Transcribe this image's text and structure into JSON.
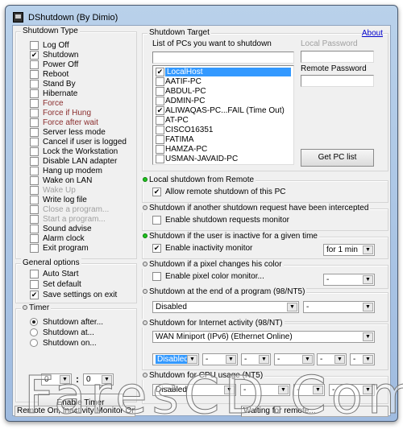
{
  "window": {
    "title": "DShutdown (By Dimio)"
  },
  "shutdown_type": {
    "label": "Shutdown Type",
    "items": [
      {
        "label": "Log Off",
        "checked": false,
        "style": "normal"
      },
      {
        "label": "Shutdown",
        "checked": true,
        "style": "normal"
      },
      {
        "label": "Power Off",
        "checked": false,
        "style": "normal"
      },
      {
        "label": "Reboot",
        "checked": false,
        "style": "normal"
      },
      {
        "label": "Stand By",
        "checked": false,
        "style": "normal"
      },
      {
        "label": "Hibernate",
        "checked": false,
        "style": "normal"
      },
      {
        "label": "Force",
        "checked": false,
        "style": "red"
      },
      {
        "label": "Force if Hung",
        "checked": false,
        "style": "red"
      },
      {
        "label": "Force after wait",
        "checked": false,
        "style": "red"
      },
      {
        "label": "Server less mode",
        "checked": false,
        "style": "normal"
      },
      {
        "label": "Cancel if user is logged",
        "checked": false,
        "style": "normal"
      },
      {
        "label": "Lock the Workstation",
        "checked": false,
        "style": "normal"
      },
      {
        "label": "Disable LAN adapter",
        "checked": false,
        "style": "normal"
      },
      {
        "label": "Hang up modem",
        "checked": false,
        "style": "normal"
      },
      {
        "label": "Wake on LAN",
        "checked": false,
        "style": "normal"
      },
      {
        "label": "Wake Up",
        "checked": false,
        "style": "disabled"
      },
      {
        "label": "Write log file",
        "checked": false,
        "style": "normal"
      },
      {
        "label": "Close a program...",
        "checked": false,
        "style": "disabled"
      },
      {
        "label": "Start a program...",
        "checked": false,
        "style": "disabled"
      },
      {
        "label": "Sound advise",
        "checked": false,
        "style": "normal"
      },
      {
        "label": "Alarm clock",
        "checked": false,
        "style": "normal"
      },
      {
        "label": "Exit program",
        "checked": false,
        "style": "normal"
      }
    ]
  },
  "general_options": {
    "label": "General options",
    "items": [
      {
        "label": "Auto Start",
        "checked": false
      },
      {
        "label": "Set default",
        "checked": false
      },
      {
        "label": "Save settings on exit",
        "checked": true
      }
    ]
  },
  "timer": {
    "label": "Timer",
    "active": false,
    "options": [
      {
        "label": "Shutdown after...",
        "selected": true
      },
      {
        "label": "Shutdown at...",
        "selected": false
      },
      {
        "label": "Shutdown on...",
        "selected": false
      }
    ],
    "hours": "0",
    "separator": ":",
    "minutes": "0",
    "button": "Enable Timer"
  },
  "target": {
    "label": "Shutdown Target",
    "about": "About",
    "list_label": "List of PCs you want to shutdown",
    "list_input": "",
    "local_password_label": "Local Password",
    "local_password": "",
    "remote_password_label": "Remote Password",
    "remote_password": "",
    "get_pc_list": "Get PC list",
    "pcs": [
      {
        "name": "LocalHost",
        "checked": true,
        "selected": true
      },
      {
        "name": "AATIF-PC",
        "checked": false
      },
      {
        "name": "ABDUL-PC",
        "checked": false
      },
      {
        "name": "ADMIN-PC",
        "checked": false
      },
      {
        "name": "ALIWAQAS-PC...FAIL (Time Out)",
        "checked": true
      },
      {
        "name": "AT-PC",
        "checked": false
      },
      {
        "name": "CISCO16351",
        "checked": false
      },
      {
        "name": "FATIMA",
        "checked": false
      },
      {
        "name": "HAMZA-PC",
        "checked": false
      },
      {
        "name": "USMAN-JAVAID-PC",
        "checked": false
      }
    ]
  },
  "remote": {
    "label": "Local shutdown from Remote",
    "active": true,
    "option": "Allow remote shutdown of this PC",
    "checked": true
  },
  "intercept": {
    "label": "Shutdown if another shutdown request have been intercepted",
    "active": false,
    "option": "Enable shutdown requests monitor",
    "checked": false
  },
  "inactive": {
    "label": "Shutdown if the user is inactive for a given time",
    "active": true,
    "option": "Enable inactivity monitor",
    "checked": true,
    "duration": "for 1 min"
  },
  "pixel": {
    "label": "Shutdown if a pixel changes his color",
    "active": false,
    "option": "Enable pixel color monitor...",
    "checked": false,
    "value": "-"
  },
  "program_end": {
    "label": "Shutdown at the end of a program (98/NT5)",
    "active": false,
    "program": "Disabled",
    "value": "-"
  },
  "internet": {
    "label": "Shutdown for Internet activity (98/NT)",
    "active": false,
    "adapter": "WAN Miniport (IPv6) (Ethernet Online)",
    "mode": "Disabled",
    "values": [
      "-",
      "-",
      "-",
      "-",
      "-"
    ]
  },
  "cpu": {
    "label": "Shutdown for CPU usage (NT5)",
    "active": false,
    "mode": "Disabled",
    "values": [
      "-",
      "-",
      "-"
    ]
  },
  "status": {
    "left": "Remote On, Inactivity Monitor On",
    "right": "Waiting for remote..."
  },
  "watermark": "FaresCD.Com",
  "colors": {
    "selection": "#3399ff",
    "active_dot": "#1ec31e",
    "force_text": "#8b2e2e"
  }
}
